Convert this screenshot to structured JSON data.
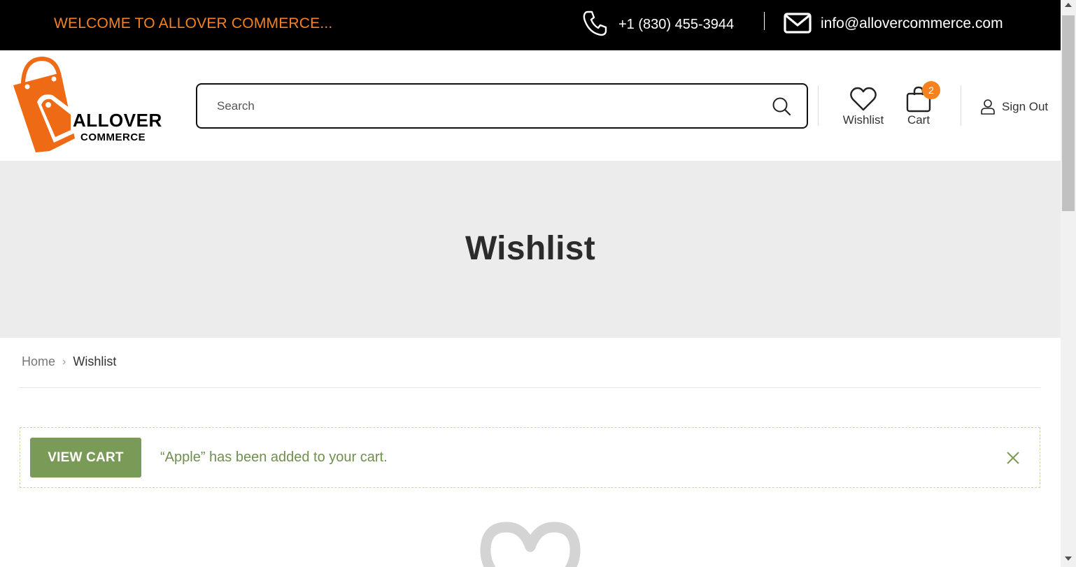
{
  "topbar": {
    "welcome": "WELCOME TO ALLOVER COMMERCE...",
    "phone": "+1 (830) 455-3944",
    "email": "info@allovercommerce.com"
  },
  "header": {
    "logo": {
      "word1": "ALLOVER",
      "word2": "COMMERCE"
    },
    "search": {
      "placeholder": "Search",
      "value": ""
    },
    "wishlist_label": "Wishlist",
    "cart_label": "Cart",
    "cart_count": "2",
    "signout_label": "Sign Out"
  },
  "page": {
    "title": "Wishlist"
  },
  "breadcrumb": {
    "home": "Home",
    "current": "Wishlist"
  },
  "notice": {
    "button_label": "VIEW CART",
    "message": "“Apple” has been added to your cart."
  },
  "colors": {
    "accent": "#f5821f",
    "topbar_bg": "#000000",
    "title_band_bg": "#ececec",
    "success_green": "#7a9a58"
  },
  "icons": [
    "phone-icon",
    "mail-icon",
    "search-icon",
    "heart-icon",
    "bag-icon",
    "user-icon",
    "chevron-right-icon",
    "close-icon",
    "empty-heart-icon"
  ]
}
